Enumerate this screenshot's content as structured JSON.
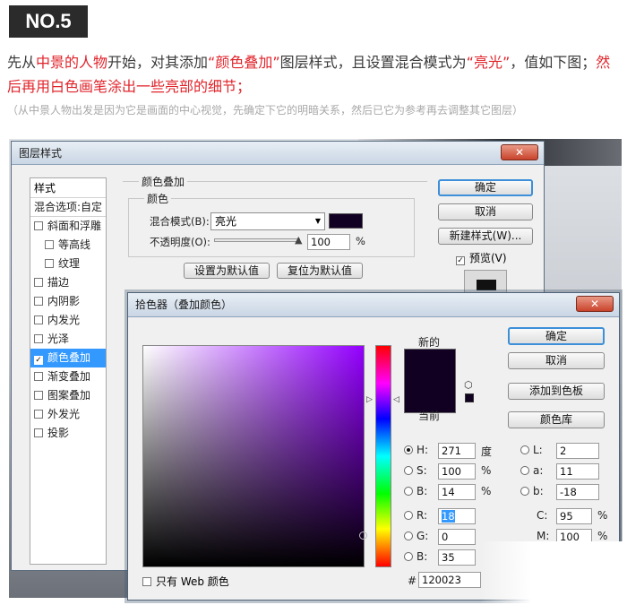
{
  "header": {
    "badge": "NO.5",
    "intro_parts": [
      {
        "text": "先从",
        "red": false
      },
      {
        "text": "中景的人物",
        "red": true
      },
      {
        "text": "开始，对其添加",
        "red": false
      },
      {
        "text": "“颜色叠加”",
        "red": true
      },
      {
        "text": "图层样式，且设置混合模式为",
        "red": false
      },
      {
        "text": "“亮光”",
        "red": true
      },
      {
        "text": "，值如下图；",
        "red": false
      },
      {
        "text": "然后再用白色画笔涂出一些亮部的细节；",
        "red": true
      }
    ],
    "note": "（从中景人物出发是因为它是画面的中心视觉，先确定下它的明暗关系，然后已它为参考再去调整其它图层）"
  },
  "layer_style_dialog": {
    "title": "图层样式",
    "close": "✕",
    "styles_header": "样式",
    "blend_options": "混合选项:自定",
    "items": [
      {
        "label": "斜面和浮雕",
        "checked": false,
        "indent": false,
        "selected": false
      },
      {
        "label": "等高线",
        "checked": false,
        "indent": true,
        "selected": false
      },
      {
        "label": "纹理",
        "checked": false,
        "indent": true,
        "selected": false
      },
      {
        "label": "描边",
        "checked": false,
        "indent": false,
        "selected": false
      },
      {
        "label": "内阴影",
        "checked": false,
        "indent": false,
        "selected": false
      },
      {
        "label": "内发光",
        "checked": false,
        "indent": false,
        "selected": false
      },
      {
        "label": "光泽",
        "checked": false,
        "indent": false,
        "selected": false
      },
      {
        "label": "颜色叠加",
        "checked": true,
        "indent": false,
        "selected": true
      },
      {
        "label": "渐变叠加",
        "checked": false,
        "indent": false,
        "selected": false
      },
      {
        "label": "图案叠加",
        "checked": false,
        "indent": false,
        "selected": false
      },
      {
        "label": "外发光",
        "checked": false,
        "indent": false,
        "selected": false
      },
      {
        "label": "投影",
        "checked": false,
        "indent": false,
        "selected": false
      }
    ],
    "section_title": "颜色叠加",
    "group_title": "颜色",
    "blend_mode_label": "混合模式(B):",
    "blend_mode_value": "亮光",
    "opacity_label": "不透明度(O):",
    "opacity_value": "100",
    "opacity_unit": "%",
    "opacity_fraction": 1.0,
    "set_default": "设置为默认值",
    "reset_default": "复位为默认值",
    "ok": "确定",
    "cancel": "取消",
    "new_style": "新建样式(W)...",
    "preview_label": "预览(V)",
    "preview_checked": true,
    "overlay_color": "#120023"
  },
  "color_picker": {
    "title": "拾色器（叠加颜色）",
    "close": "✕",
    "new_label": "新的",
    "current_label": "当前",
    "ok": "确定",
    "cancel": "取消",
    "add_swatch": "添加到色板",
    "color_library": "颜色库",
    "hsb": [
      {
        "label": "H:",
        "value": "271",
        "unit": "度",
        "selected": true
      },
      {
        "label": "S:",
        "value": "100",
        "unit": "%",
        "selected": false
      },
      {
        "label": "B:",
        "value": "14",
        "unit": "%",
        "selected": false
      }
    ],
    "rgb": [
      {
        "label": "R:",
        "value": "18",
        "selected": false,
        "highlight": true
      },
      {
        "label": "G:",
        "value": "0",
        "selected": false,
        "highlight": false
      },
      {
        "label": "B:",
        "value": "35",
        "selected": false,
        "highlight": false
      }
    ],
    "lab": [
      {
        "label": "L:",
        "value": "2"
      },
      {
        "label": "a:",
        "value": "11"
      },
      {
        "label": "b:",
        "value": "-18"
      }
    ],
    "cmyk": [
      {
        "label": "C:",
        "value": "95",
        "unit": "%"
      },
      {
        "label": "M:",
        "value": "100",
        "unit": "%"
      }
    ],
    "hex_label": "#",
    "hex_value": "120023",
    "web_only_label": "只有 Web 颜色",
    "web_only_checked": false,
    "color": "#120023"
  }
}
